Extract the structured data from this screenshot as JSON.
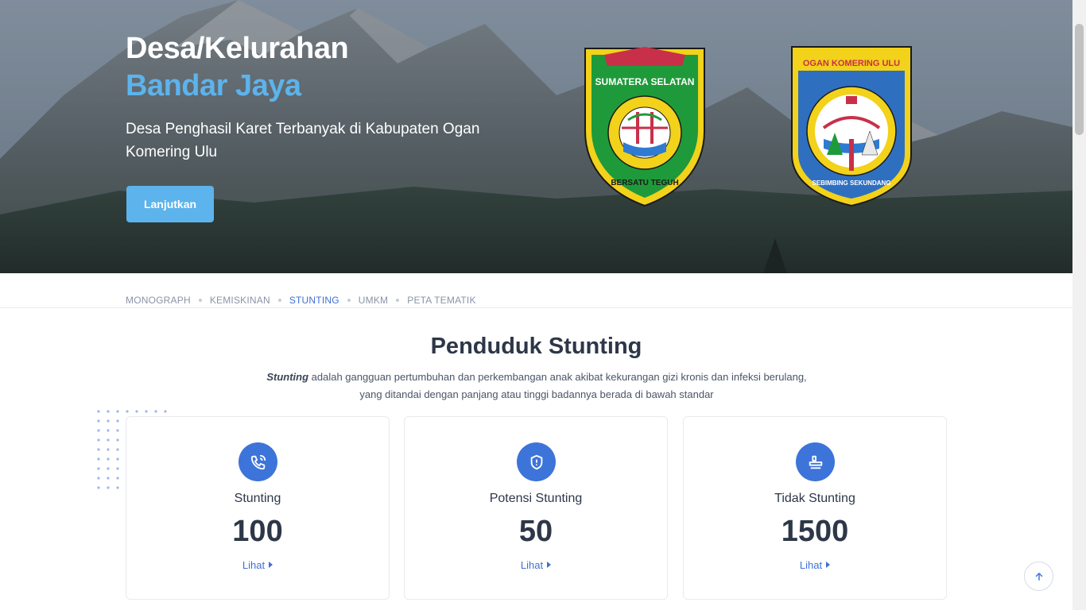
{
  "hero": {
    "title_line1": "Desa/Kelurahan",
    "title_line2": "Bandar Jaya",
    "tagline": "Desa Penghasil Karet Terbanyak di Kabupaten Ogan Komering Ulu",
    "cta_label": "Lanjutkan",
    "accent_color": "#5db3ec"
  },
  "logos": {
    "sumsel": {
      "top_text": "SUMATERA SELATAN",
      "bottom_text": "BERSATU TEGUH"
    },
    "oku": {
      "top_text": "OGAN KOMERING ULU",
      "bottom_text": "SEBIMBING SEKUNDANG"
    }
  },
  "tabs": [
    {
      "label": "MONOGRAPH",
      "active": false
    },
    {
      "label": "KEMISKINAN",
      "active": false
    },
    {
      "label": "STUNTING",
      "active": true
    },
    {
      "label": "UMKM",
      "active": false
    },
    {
      "label": "PETA TEMATIK",
      "active": false
    }
  ],
  "section": {
    "title": "Penduduk Stunting",
    "description_term": "Stunting",
    "description_rest": " adalah gangguan pertumbuhan dan perkembangan anak akibat kekurangan gizi kronis dan infeksi berulang, yang ditandai dengan panjang atau tinggi badannya berada di bawah standar"
  },
  "cards": [
    {
      "icon": "phone-call-icon",
      "label": "Stunting",
      "value": "100",
      "link": "Lihat"
    },
    {
      "icon": "shield-alert-icon",
      "label": "Potensi Stunting",
      "value": "50",
      "link": "Lihat"
    },
    {
      "icon": "stamp-icon",
      "label": "Tidak Stunting",
      "value": "1500",
      "link": "Lihat"
    }
  ],
  "colors": {
    "primary": "#3d74d9",
    "text": "#2d3748",
    "muted": "#8a94a6"
  }
}
